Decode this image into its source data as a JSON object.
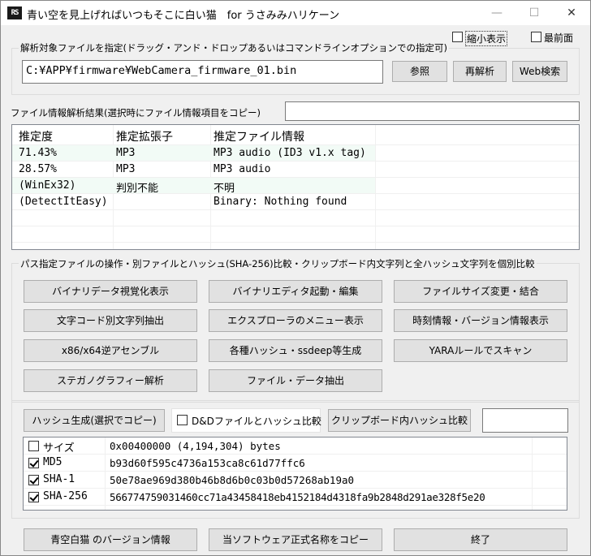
{
  "window": {
    "title": "青い空を見上げればいつもそこに白い猫　for うさみみハリケーン",
    "icon_text": "RS",
    "minimize": "—",
    "maximize": "☐",
    "close": "✕"
  },
  "options": {
    "compact_label": "縮小表示",
    "compact_checked": false,
    "topmost_label": "最前面",
    "topmost_checked": false
  },
  "target": {
    "group_label": "解析対象ファイルを指定(ドラッグ・アンド・ドロップあるいはコマンドラインオプションでの指定可)",
    "path_value": "C:¥APP¥firmware¥WebCamera_firmware_01.bin",
    "browse_label": "参照",
    "reanalyze_label": "再解析",
    "websearch_label": "Web検索"
  },
  "result": {
    "label": "ファイル情報解析結果(選択時にファイル情報項目をコピー)",
    "copy_field_value": "",
    "columns": [
      "推定度",
      "推定拡張子",
      "推定ファイル情報"
    ],
    "rows": [
      {
        "score": " 71.43%",
        "ext": "MP3",
        "info": "MP3 audio (ID3 v1.x tag)"
      },
      {
        "score": " 28.57%",
        "ext": "MP3",
        "info": "MP3 audio"
      },
      {
        "score": "(WinEx32)",
        "ext": "判別不能",
        "info": "不明"
      },
      {
        "score": "(DetectItEasy)",
        "ext": "",
        "info": "Binary: Nothing found"
      }
    ]
  },
  "operations": {
    "group_label": "パス指定ファイルの操作・別ファイルとハッシュ(SHA-256)比較・クリップボード内文字列と全ハッシュ文字列を個別比較",
    "buttons": [
      "バイナリデータ視覚化表示",
      "バイナリエディタ起動・編集",
      "ファイルサイズ変更・結合",
      "文字コード別文字列抽出",
      "エクスプローラのメニュー表示",
      "時刻情報・バージョン情報表示",
      "x86/x64逆アセンブル",
      "各種ハッシュ・ssdeep等生成",
      "YARAルールでスキャン",
      "ステガノグラフィー解析",
      "ファイル・データ抽出"
    ]
  },
  "hash": {
    "generate_label": "ハッシュ生成(選択でコピー)",
    "dd_compare_label": "D&Dファイルとハッシュ比較",
    "dd_compare_checked": false,
    "clipboard_compare_label": "クリップボード内ハッシュ比較",
    "compare_field_value": "",
    "rows": [
      {
        "name": "サイズ",
        "checked": false,
        "value": "0x00400000 (4,194,304) bytes"
      },
      {
        "name": "MD5",
        "checked": true,
        "value": "b93d60f595c4736a153ca8c61d77ffc6"
      },
      {
        "name": "SHA-1",
        "checked": true,
        "value": "50e78ae969d380b46b8d6b0c03b0d57268ab19a0"
      },
      {
        "name": "SHA-256",
        "checked": true,
        "value": "566774759031460cc71a43458418eb4152184d4318fa9b2848d291ae328f5e20"
      }
    ]
  },
  "footer": {
    "version_label": "青空白猫 のバージョン情報",
    "copy_name_label": "当ソフトウェア正式名称をコピー",
    "exit_label": "終了"
  }
}
